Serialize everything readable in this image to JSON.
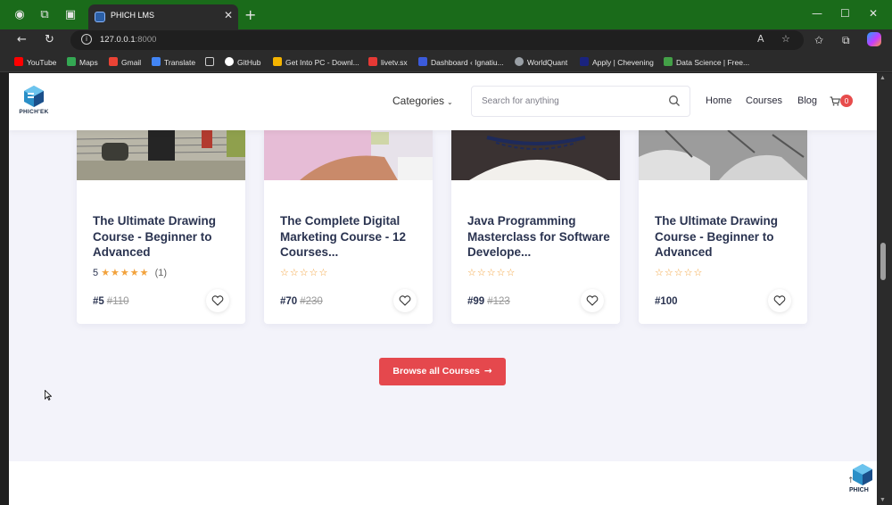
{
  "browser": {
    "tab_title": "PHICH LMS",
    "url_host": "127.0.0.1",
    "url_port": ":8000",
    "bookmarks": [
      {
        "label": "YouTube",
        "color": "#ff0000"
      },
      {
        "label": "Maps",
        "color": "#34a853"
      },
      {
        "label": "Gmail",
        "color": "#ea4335"
      },
      {
        "label": "Translate",
        "color": "#4285f4"
      },
      {
        "label": "",
        "color": "#cccccc"
      },
      {
        "label": "GitHub",
        "color": "#ffffff"
      },
      {
        "label": "Get Into PC - Downl...",
        "color": "#f4b400"
      },
      {
        "label": "livetv.sx",
        "color": "#e53935"
      },
      {
        "label": "Dashboard ‹ Ignatiu...",
        "color": "#3b5bdb"
      },
      {
        "label": "WorldQuant",
        "color": "#9aa0a6"
      },
      {
        "label": "Apply | Chevening",
        "color": "#1a237e"
      },
      {
        "label": "Data Science | Free...",
        "color": "#43a047"
      }
    ]
  },
  "header": {
    "logo_text": "PHICH'EK",
    "categories_label": "Categories",
    "search_placeholder": "Search for anything",
    "nav": [
      "Home",
      "Courses",
      "Blog"
    ],
    "cart_count": "0"
  },
  "courses": [
    {
      "title": "The Ultimate Drawing Course - Beginner to Advanced",
      "rating_value": "5",
      "rating_count": "(1)",
      "stars_filled": 5,
      "price": "#5",
      "old_price": "#110"
    },
    {
      "title": "The Complete Digital Marketing Course - 12 Courses...",
      "rating_value": "",
      "rating_count": "",
      "stars_filled": 0,
      "price": "#70",
      "old_price": "#230"
    },
    {
      "title": "Java Programming Masterclass for Software Develope...",
      "rating_value": "",
      "rating_count": "",
      "stars_filled": 0,
      "price": "#99",
      "old_price": "#123"
    },
    {
      "title": "The Ultimate Drawing Course - Beginner to Advanced",
      "rating_value": "",
      "rating_count": "",
      "stars_filled": 0,
      "price": "#100",
      "old_price": ""
    }
  ],
  "browse_button": "Browse all Courses",
  "float_logo_text": "PHICH"
}
